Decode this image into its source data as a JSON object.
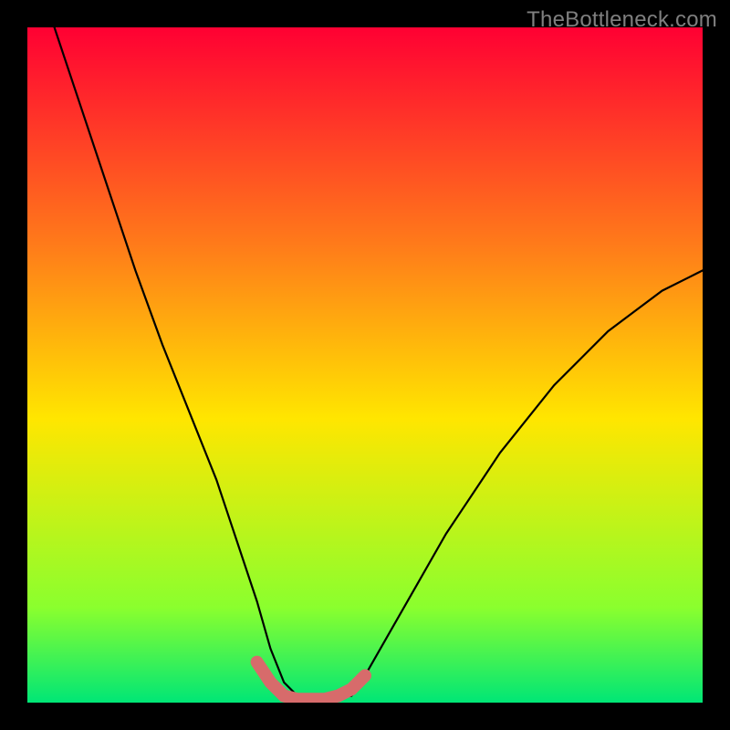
{
  "watermark": "TheBottleneck.com",
  "chart_data": {
    "type": "line",
    "title": "",
    "xlabel": "",
    "ylabel": "",
    "xlim": [
      0,
      100
    ],
    "ylim": [
      0,
      100
    ],
    "background_gradient": [
      "#ff0033",
      "#ff7a1a",
      "#ffe600",
      "#8aff2e",
      "#00e676"
    ],
    "series": [
      {
        "name": "curve",
        "color": "#000000",
        "x": [
          4,
          8,
          12,
          16,
          20,
          24,
          28,
          31,
          34,
          36,
          38,
          40,
          44,
          48,
          50,
          54,
          58,
          62,
          66,
          70,
          74,
          78,
          82,
          86,
          90,
          94,
          98,
          100
        ],
        "y": [
          100,
          88,
          76,
          64,
          53,
          43,
          33,
          24,
          15,
          8,
          3,
          1,
          0.5,
          1,
          4,
          11,
          18,
          25,
          31,
          37,
          42,
          47,
          51,
          55,
          58,
          61,
          63,
          64
        ]
      },
      {
        "name": "trough-highlight",
        "color": "#d76b6b",
        "x": [
          34,
          36,
          38,
          40,
          42,
          44,
          46,
          48,
          50
        ],
        "y": [
          6,
          3,
          1,
          0.5,
          0.5,
          0.5,
          1,
          2,
          4
        ]
      }
    ],
    "annotations": []
  },
  "colors": {
    "frame": "#000000",
    "curve": "#000000",
    "highlight": "#d76b6b",
    "watermark": "#7f7f7f"
  }
}
